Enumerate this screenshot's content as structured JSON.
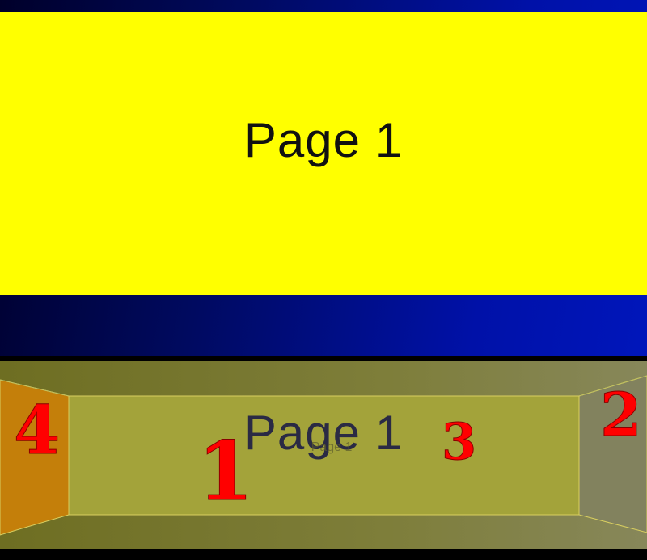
{
  "top_view": {
    "page_label": "Page 1"
  },
  "bottom_view": {
    "center_label": "Page 1",
    "ghost_label": "Page 1",
    "faces": [
      {
        "number": "1"
      },
      {
        "number": "2"
      },
      {
        "number": "3"
      },
      {
        "number": "4"
      }
    ]
  },
  "colors": {
    "page_background": "#ffff00",
    "top_panel_gradient_start": "#00002a",
    "top_panel_gradient_end": "#0016bb",
    "face_number": "#ff0000",
    "bottom_panel": "#7e7e3a",
    "left_face": "#c47f0a",
    "right_face": "#82825e",
    "center_face": "#a3a33a"
  }
}
